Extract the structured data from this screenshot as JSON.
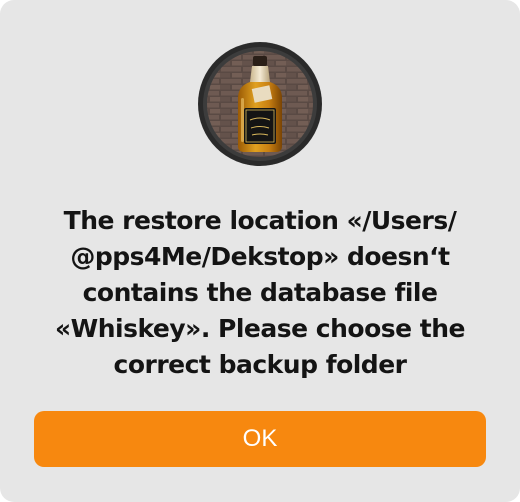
{
  "dialog": {
    "icon": "whiskey-bottle-icon",
    "message_lines": [
      "The restore location «/Users/",
      "@pps4Me/Dekstop» doesn‘t",
      "contains the database file",
      "«Whiskey». Please choose the",
      "correct backup folder"
    ],
    "ok_label": "OK"
  },
  "colors": {
    "dialog_background": "#e6e6e6",
    "button_accent": "#f7880f",
    "button_text": "#ffffff",
    "message_text": "#141414"
  }
}
